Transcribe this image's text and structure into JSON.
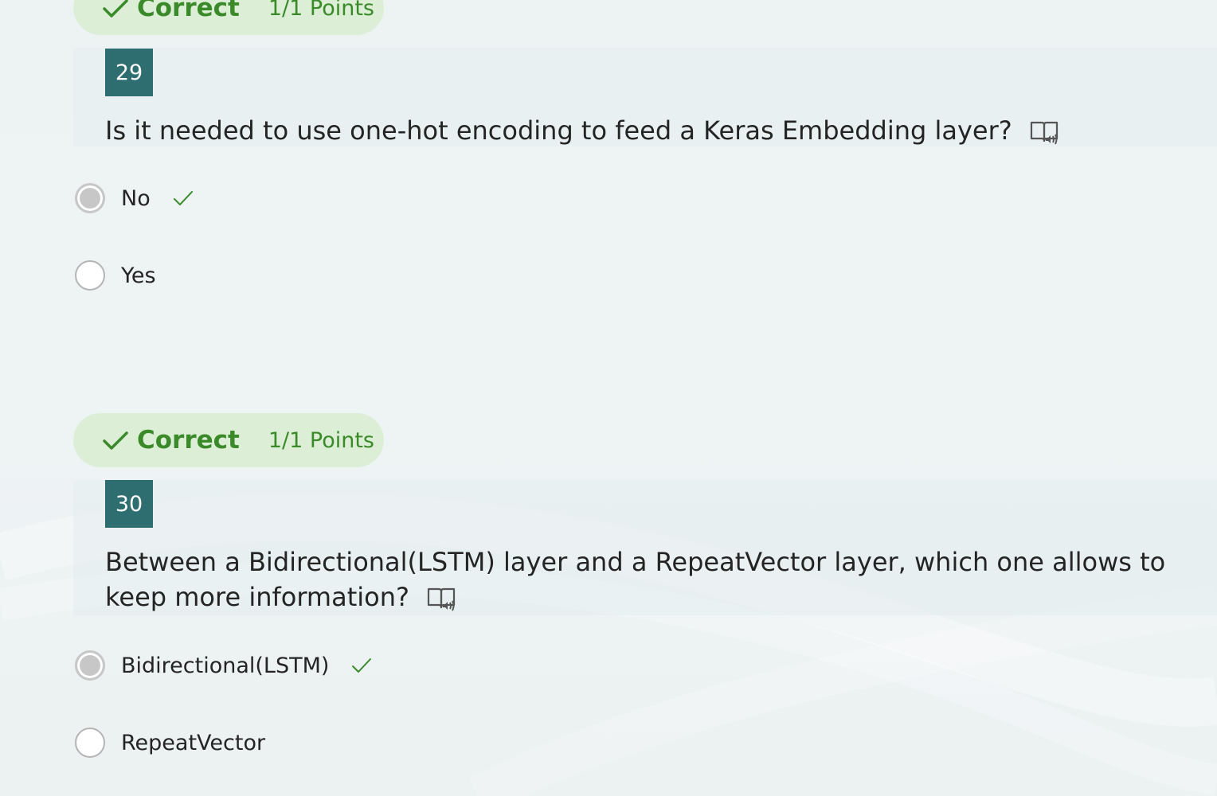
{
  "questions": [
    {
      "result": {
        "status": "Correct",
        "points": "1/1 Points"
      },
      "number": "29",
      "text": "Is it needed to use one-hot encoding to feed a Keras Embedding layer?",
      "options": [
        {
          "label": "No",
          "selected": true,
          "marked_correct": true
        },
        {
          "label": "Yes",
          "selected": false,
          "marked_correct": false
        }
      ]
    },
    {
      "result": {
        "status": "Correct",
        "points": "1/1 Points"
      },
      "number": "30",
      "text": "Between a Bidirectional(LSTM) layer and a RepeatVector layer, which one allows to keep more information?",
      "options": [
        {
          "label": "Bidirectional(LSTM)",
          "selected": true,
          "marked_correct": true
        },
        {
          "label": "RepeatVector",
          "selected": false,
          "marked_correct": false
        }
      ]
    }
  ],
  "colors": {
    "correct_green": "#3a8a2a",
    "pill_bg": "#dcefd6",
    "number_badge": "#2e6d70"
  },
  "icons": {
    "status": "checkmark-icon",
    "reader": "immersive-reader-icon",
    "answer": "correct-answer-check-icon"
  }
}
